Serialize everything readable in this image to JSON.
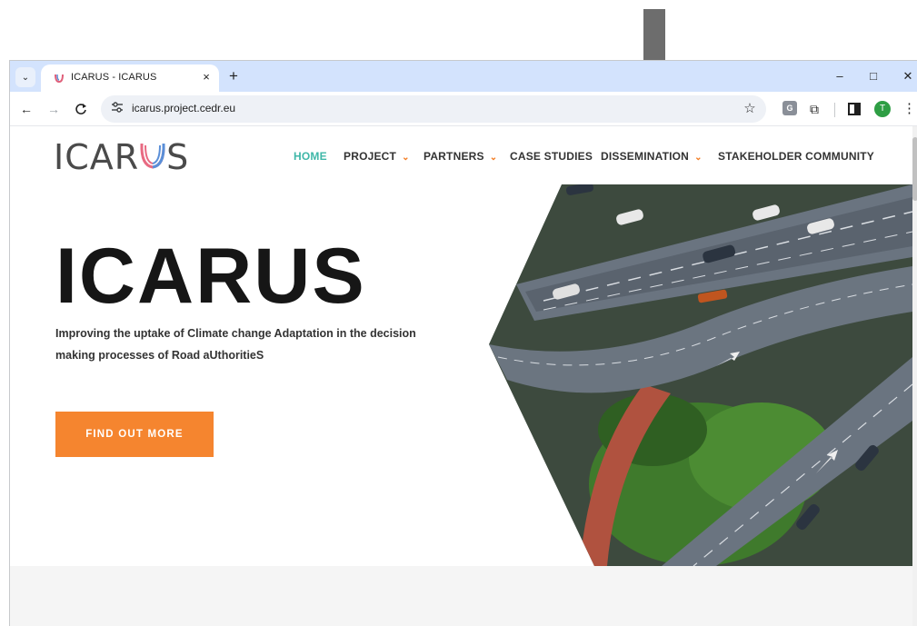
{
  "browser": {
    "tab_title": "ICARUS - ICARUS",
    "url": "icarus.project.cedr.eu",
    "new_tab_symbol": "+",
    "tab_close_symbol": "×",
    "minimize_symbol": "–",
    "maximize_symbol": "□",
    "close_symbol": "✕",
    "profile_initial": "T",
    "extension_letter": "G"
  },
  "site": {
    "logo_text_left": "ICAR",
    "logo_text_right": "S",
    "nav": {
      "home": "HOME",
      "project": "PROJECT",
      "partners": "PARTNERS",
      "case_studies": "CASE STUDIES",
      "dissemination": "DISSEMINATION",
      "stakeholder": "STAKEHOLDER COMMUNITY"
    },
    "active_color": "#3fb7a8",
    "accent_color": "#f5852f"
  },
  "hero": {
    "title": "ICARUS",
    "subtitle": "Improving the uptake of Climate change Adaptation in the decision making processes of Road aUthoritieS",
    "cta_label": "FIND OUT MORE"
  },
  "icons": {
    "arrow": "down-arrow-annotation",
    "back": "←",
    "forward": "→",
    "reload": "C",
    "star": "☆",
    "puzzle": "⧉",
    "menu": "⋮",
    "chevron": "⌄",
    "tab_search": "⌄",
    "site_info": "⚟"
  }
}
